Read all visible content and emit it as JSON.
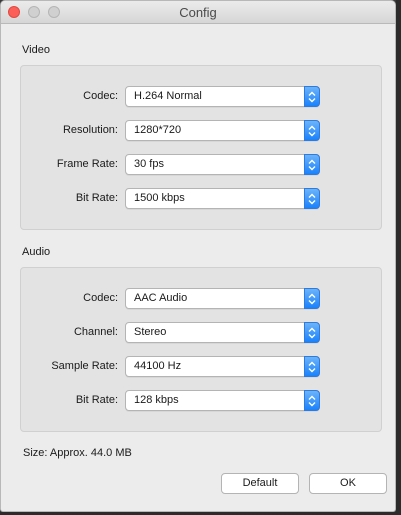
{
  "window": {
    "title": "Config"
  },
  "video": {
    "section_label": "Video",
    "rows": [
      {
        "label": "Codec:",
        "value": "H.264 Normal"
      },
      {
        "label": "Resolution:",
        "value": "1280*720"
      },
      {
        "label": "Frame Rate:",
        "value": "30 fps"
      },
      {
        "label": "Bit Rate:",
        "value": "1500 kbps"
      }
    ]
  },
  "audio": {
    "section_label": "Audio",
    "rows": [
      {
        "label": "Codec:",
        "value": "AAC Audio"
      },
      {
        "label": "Channel:",
        "value": "Stereo"
      },
      {
        "label": "Sample Rate:",
        "value": "44100 Hz"
      },
      {
        "label": "Bit Rate:",
        "value": "128 kbps"
      }
    ]
  },
  "footer": {
    "size_text": "Size: Approx. 44.0 MB",
    "default_label": "Default",
    "ok_label": "OK"
  },
  "colors": {
    "close_button": "#fc5f57",
    "stepper_accent": "#1a82fb"
  },
  "icons": {
    "stepper": "up-down-chevron-icon"
  }
}
